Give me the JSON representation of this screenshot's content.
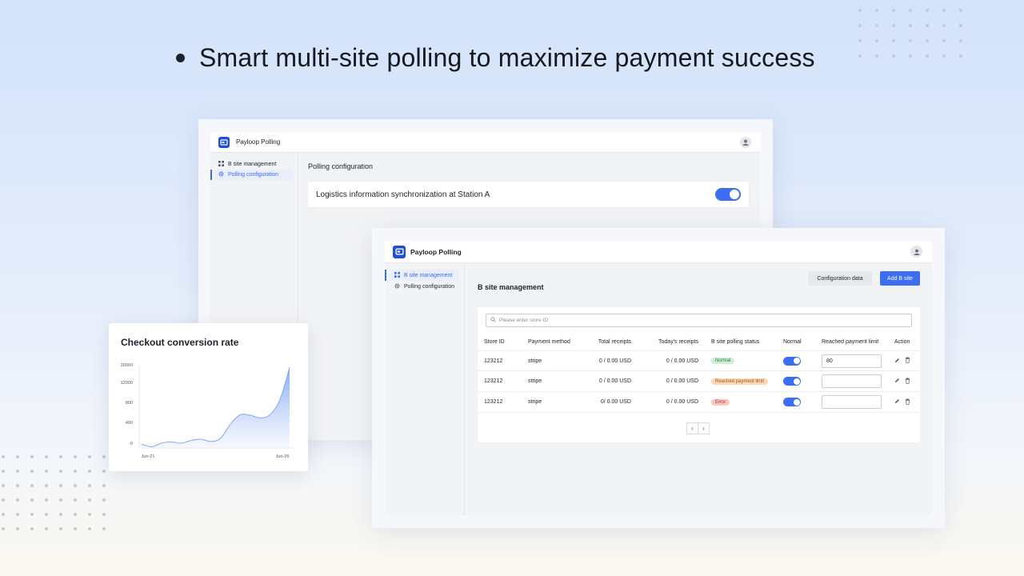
{
  "headline": "Smart multi-site polling to maximize payment success",
  "app_title": "Payloop Polling",
  "sidebar": {
    "items": [
      {
        "label": "B site management"
      },
      {
        "label": "Polling configuration"
      }
    ]
  },
  "back_window": {
    "active_item": "Polling configuration",
    "section_title": "Polling configuration",
    "setting_label": "Logistics information synchronization at Station A",
    "setting_enabled": true
  },
  "front_window": {
    "active_item": "B site management",
    "section_title": "B site management",
    "config_button": "Configuration data",
    "add_button": "Add B site",
    "search_placeholder": "Please enter store ID",
    "columns": [
      "Store ID",
      "Payment method",
      "Total receipts",
      "Today's receipts",
      "B site polling status",
      "Normal",
      "Reached payment limit",
      "Action"
    ],
    "rows": [
      {
        "store_id": "123212",
        "method": "stripe",
        "total": "0 / 0.00 USD",
        "today": "0 / 0.00 USD",
        "status": "Normal",
        "status_kind": "ok",
        "normal": true,
        "limit": "80"
      },
      {
        "store_id": "123212",
        "method": "stripe",
        "total": "0 / 0.00 USD",
        "today": "0 / 0.00 USD",
        "status": "Reached payment limit",
        "status_kind": "warn",
        "normal": true,
        "limit": ""
      },
      {
        "store_id": "123212",
        "method": "stripe",
        "total": "0/ 0.00 USD",
        "today": "0 / 0.00 USD",
        "status": "Error",
        "status_kind": "err",
        "normal": true,
        "limit": ""
      }
    ],
    "pager": {
      "prev": "‹",
      "next": "›"
    }
  },
  "chart_data": {
    "type": "area",
    "title": "Checkout conversion rate",
    "xlabel": "",
    "ylabel": "",
    "x_ticks": [
      "Jun-21",
      "Jun-26"
    ],
    "y_ticks": [
      "20000",
      "12000",
      "800",
      "400",
      "0"
    ],
    "series": [
      {
        "values": [
          700,
          100,
          900,
          1200,
          900,
          1500,
          1800,
          1300,
          2000,
          5200,
          7300,
          7200,
          6600,
          7300,
          10600,
          18000
        ]
      }
    ],
    "ylim": [
      0,
      20000
    ],
    "grid": false,
    "colors": {
      "fill_top": "#7fa6f4",
      "fill_bottom": "#eef3fd",
      "line": "#86a8f3"
    }
  },
  "colors": {
    "accent": "#3b6ef0",
    "brand": "#1f4fd9"
  }
}
